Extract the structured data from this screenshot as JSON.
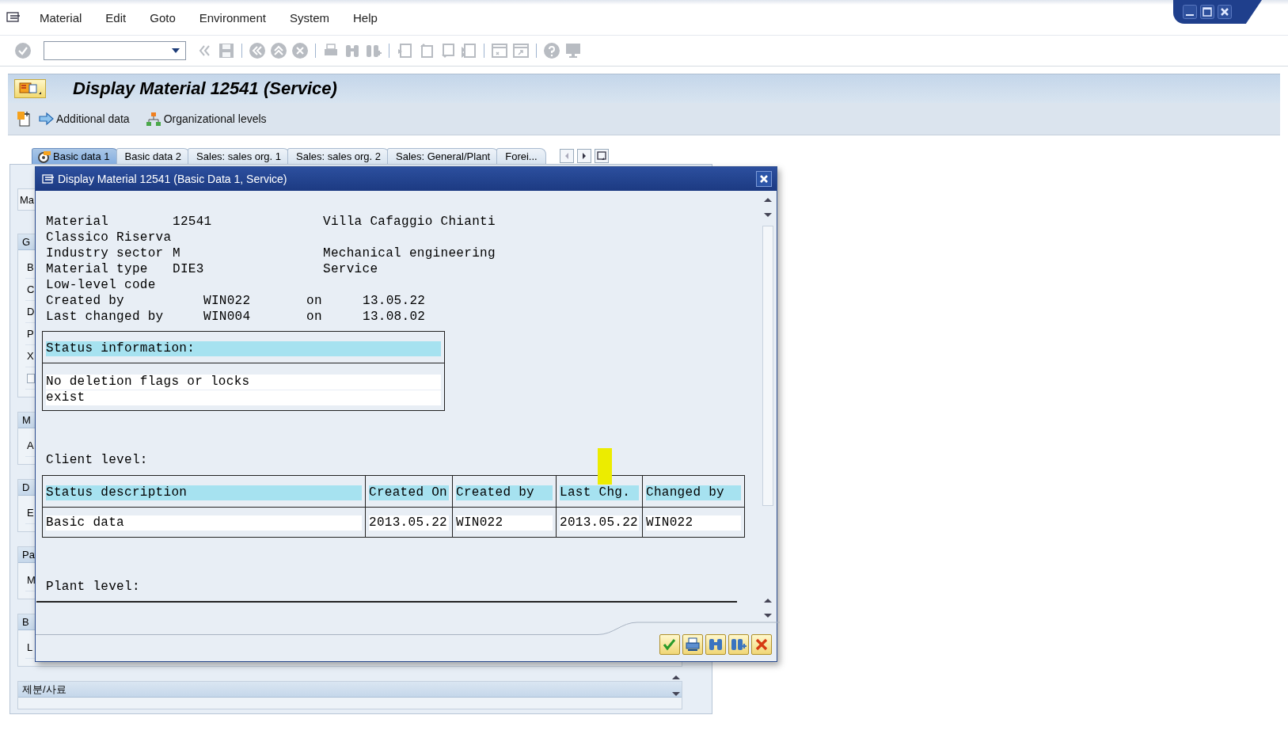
{
  "menu": [
    {
      "label": "Material"
    },
    {
      "label": "Edit"
    },
    {
      "label": "Goto"
    },
    {
      "label": "Environment"
    },
    {
      "label": "System"
    },
    {
      "label": "Help"
    }
  ],
  "title": "Display Material 12541 (Service)",
  "app_toolbar": [
    {
      "label": "Additional data"
    },
    {
      "label": "Organizational levels"
    }
  ],
  "tabs": [
    {
      "label": "Basic data 1",
      "selected": true
    },
    {
      "label": "Basic data 2",
      "selected": false
    },
    {
      "label": "Sales: sales org. 1",
      "selected": false
    },
    {
      "label": "Sales: sales org. 2",
      "selected": false
    },
    {
      "label": "Sales: General/Plant",
      "selected": false
    },
    {
      "label": "Forei...",
      "selected": false
    }
  ],
  "background_panel": {
    "field": "Ma",
    "groups": [
      {
        "header": "G",
        "rows": [
          {
            "kind": "label",
            "text": "B"
          },
          {
            "kind": "label",
            "text": "C"
          },
          {
            "kind": "label",
            "text": "D"
          },
          {
            "kind": "label",
            "text": "P"
          },
          {
            "kind": "label",
            "text": "X"
          },
          {
            "kind": "checkbox",
            "checked": false
          }
        ]
      },
      {
        "header": "M",
        "rows": [
          {
            "kind": "label",
            "text": "A"
          }
        ]
      },
      {
        "header": "D",
        "rows": [
          {
            "kind": "label",
            "text": "E"
          }
        ]
      },
      {
        "header": "Pa",
        "rows": [
          {
            "kind": "label",
            "text": "M"
          }
        ]
      },
      {
        "header": "B",
        "rows": [
          {
            "kind": "label",
            "text": "L"
          }
        ]
      },
      {
        "header": "제분/사료"
      }
    ]
  },
  "dialog": {
    "title": "Display Material 12541 (Basic Data 1, Service)",
    "lines": [
      {
        "kind": "field",
        "label": "Material",
        "value": "12541",
        "description": "Villa Cafaggio Chianti"
      },
      {
        "kind": "text",
        "text": "Classico Riserva"
      },
      {
        "kind": "field",
        "label": "Industry sector",
        "value": "M",
        "description": "Mechanical engineering"
      },
      {
        "kind": "field",
        "label": "Material type",
        "value": "DIE3",
        "description": "Service"
      },
      {
        "kind": "text",
        "text": "Low-level code"
      },
      {
        "kind": "change",
        "label": "Created by",
        "user": "WIN022",
        "on": "on",
        "date": "13.05.22"
      },
      {
        "kind": "change",
        "label": "Last changed by",
        "user": "WIN004",
        "on": "on",
        "date": "13.08.02"
      }
    ],
    "status": {
      "header": "Status information:",
      "lines": [
        "No deletion flags or locks",
        "exist"
      ]
    },
    "client_level": {
      "label": "Client level:",
      "columns": [
        {
          "label": "Status description",
          "highlight": false
        },
        {
          "label": "Created On",
          "highlight": false
        },
        {
          "label": "Created by",
          "highlight": false
        },
        {
          "label": "Last Chg.",
          "highlight": true
        },
        {
          "label": "Changed by",
          "highlight": false
        }
      ],
      "rows": [
        [
          "Basic data",
          "2013.05.22",
          "WIN022",
          "2013.05.22",
          "WIN022"
        ]
      ]
    },
    "plant_level": {
      "label": "Plant level:"
    }
  }
}
